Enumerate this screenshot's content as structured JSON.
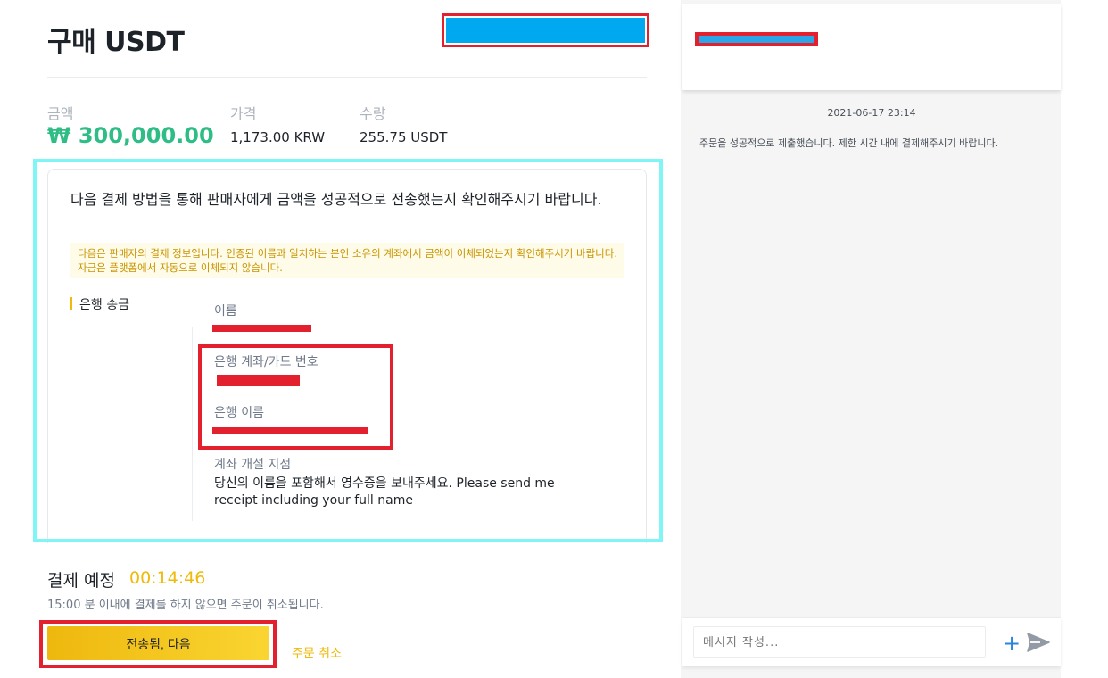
{
  "page": {
    "title": "구매 USDT"
  },
  "summary": {
    "amount_label": "금액",
    "amount_value": "₩ 300,000.00",
    "price_label": "가격",
    "price_value": "1,173.00 KRW",
    "quantity_label": "수량",
    "quantity_value": "255.75 USDT"
  },
  "payment": {
    "instruction": "다음 결제 방법을 통해 판매자에게 금액을 성공적으로 전송했는지 확인해주시기 바랍니다.",
    "notice": "다음은 판매자의 결제 정보입니다. 인증된 이름과 일치하는 본인 소유의 계좌에서 금액이 이체되었는지 확인해주시기 바랍니다. 자금은 플랫폼에서 자동으로 이체되지 않습니다.",
    "method_label": "은행 송금",
    "fields": {
      "name_label": "이름",
      "account_label": "은행 계좌/카드 번호",
      "bank_label": "은행 이름",
      "branch_label": "계좌 개설 지점",
      "branch_value": "당신의 이름을 포함해서 영수증을 보내주세요. Please send me receipt including your full name"
    }
  },
  "due": {
    "title": "결제 예정",
    "timer": "00:14:46",
    "subtitle": "15:00 분 이내에 결제를 하지 않으면 주문이 취소됩니다."
  },
  "actions": {
    "confirm_label": "전송됨, 다음",
    "cancel_label": "주문 취소"
  },
  "chat": {
    "date": "2021-06-17 23:14",
    "message": "주문을 성공적으로 제출했습니다. 제한 시간 내에 결제해주시기 바랍니다.",
    "input_placeholder": "메시지 작성...",
    "icons": [
      "plus-icon",
      "send-icon"
    ]
  },
  "colors": {
    "accent": "#f0b90b",
    "amount": "#2ebd85",
    "redaction": "#e3202d",
    "highlight_frame": "#7ff6f5"
  }
}
